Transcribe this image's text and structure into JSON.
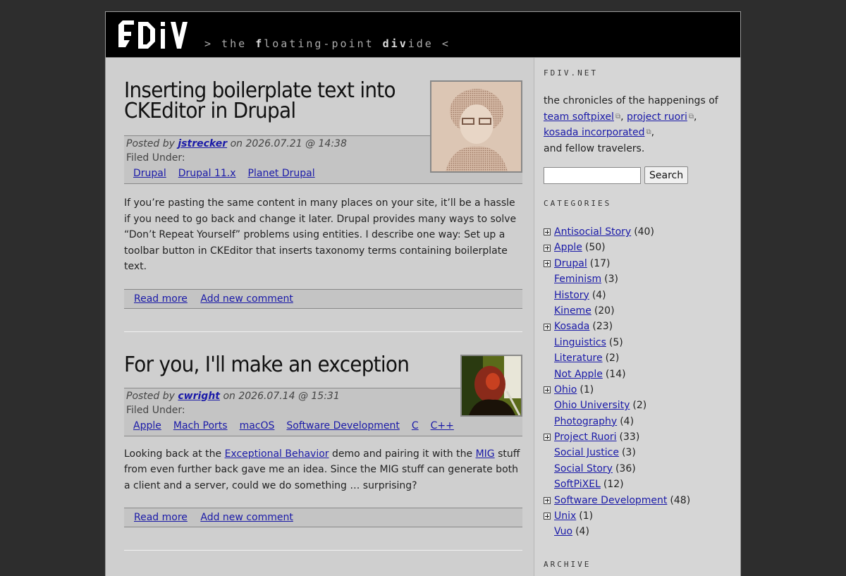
{
  "header": {
    "logo_text": "fDiV",
    "tagline_prefix": "> the ",
    "tagline_f": "f",
    "tagline_mid": "loating-point ",
    "tagline_bold": "div",
    "tagline_end": "ide <"
  },
  "articles": [
    {
      "title": "Inserting boilerplate text into CKEditor in Drupal",
      "posted_by_label": "Posted by",
      "author": "jstrecker",
      "date": "on 2026.07.21 @ 14:38",
      "filed_label": "Filed Under:",
      "tags": [
        "Drupal",
        "Drupal 11.x",
        "Planet Drupal"
      ],
      "body": "If you’re pasting the same content in many places on your site, it’ll be a hassle if you need to go back and change it later. Drupal provides many ways to solve “Don’t Repeat Yourself” problems using entities. I describe one way: Set up a toolbar button in CKEditor that inserts taxonomy terms containing boilerplate text.",
      "read_more": "Read more",
      "add_comment": "Add new comment"
    },
    {
      "title": "For you, I'll make an exception",
      "posted_by_label": "Posted by",
      "author": "cwright",
      "date": "on 2026.07.14 @ 15:31",
      "filed_label": "Filed Under:",
      "tags": [
        "Apple",
        "Mach Ports",
        "macOS",
        "Software Development",
        "C",
        "C++"
      ],
      "body_pre": "Looking back at the ",
      "body_link1": "Exceptional Behavior",
      "body_mid": " demo and pairing it with the ",
      "body_link2": "MIG",
      "body_post": " stuff from even further back gave me an idea. Since the MIG stuff can generate both a client and a server, could we do something … surprising?",
      "read_more": "Read more",
      "add_comment": "Add new comment"
    }
  ],
  "sidebar": {
    "site_title": "FDIV.NET",
    "desc_intro": "the chronicles of the happenings of",
    "link1": "team softpixel",
    "link2": "project ruori",
    "link3": "kosada incorporated",
    "desc_end": "and fellow travelers.",
    "comma": ",",
    "search_value": "",
    "search_button": "Search",
    "categories_title": "CATEGORIES",
    "categories": [
      {
        "name": "Antisocial Story",
        "count": "(40)",
        "expandable": true
      },
      {
        "name": "Apple",
        "count": "(50)",
        "expandable": true
      },
      {
        "name": "Drupal",
        "count": "(17)",
        "expandable": true
      },
      {
        "name": "Feminism",
        "count": "(3)",
        "expandable": false
      },
      {
        "name": "History",
        "count": "(4)",
        "expandable": false
      },
      {
        "name": "Kineme",
        "count": "(20)",
        "expandable": false
      },
      {
        "name": "Kosada",
        "count": "(23)",
        "expandable": true
      },
      {
        "name": "Linguistics",
        "count": "(5)",
        "expandable": false
      },
      {
        "name": "Literature",
        "count": "(2)",
        "expandable": false
      },
      {
        "name": "Not Apple",
        "count": "(14)",
        "expandable": false
      },
      {
        "name": "Ohio",
        "count": "(1)",
        "expandable": true
      },
      {
        "name": "Ohio University",
        "count": "(2)",
        "expandable": false
      },
      {
        "name": "Photography",
        "count": "(4)",
        "expandable": false
      },
      {
        "name": "Project Ruori",
        "count": "(33)",
        "expandable": true
      },
      {
        "name": "Social Justice",
        "count": "(3)",
        "expandable": false
      },
      {
        "name": "Social Story",
        "count": "(36)",
        "expandable": false
      },
      {
        "name": "SoftPiXEL",
        "count": "(12)",
        "expandable": false
      },
      {
        "name": "Software Development",
        "count": "(48)",
        "expandable": true
      },
      {
        "name": "Unix",
        "count": "(1)",
        "expandable": true
      },
      {
        "name": "Vuo",
        "count": "(4)",
        "expandable": false
      }
    ],
    "archive_title": "ARCHIVE"
  }
}
